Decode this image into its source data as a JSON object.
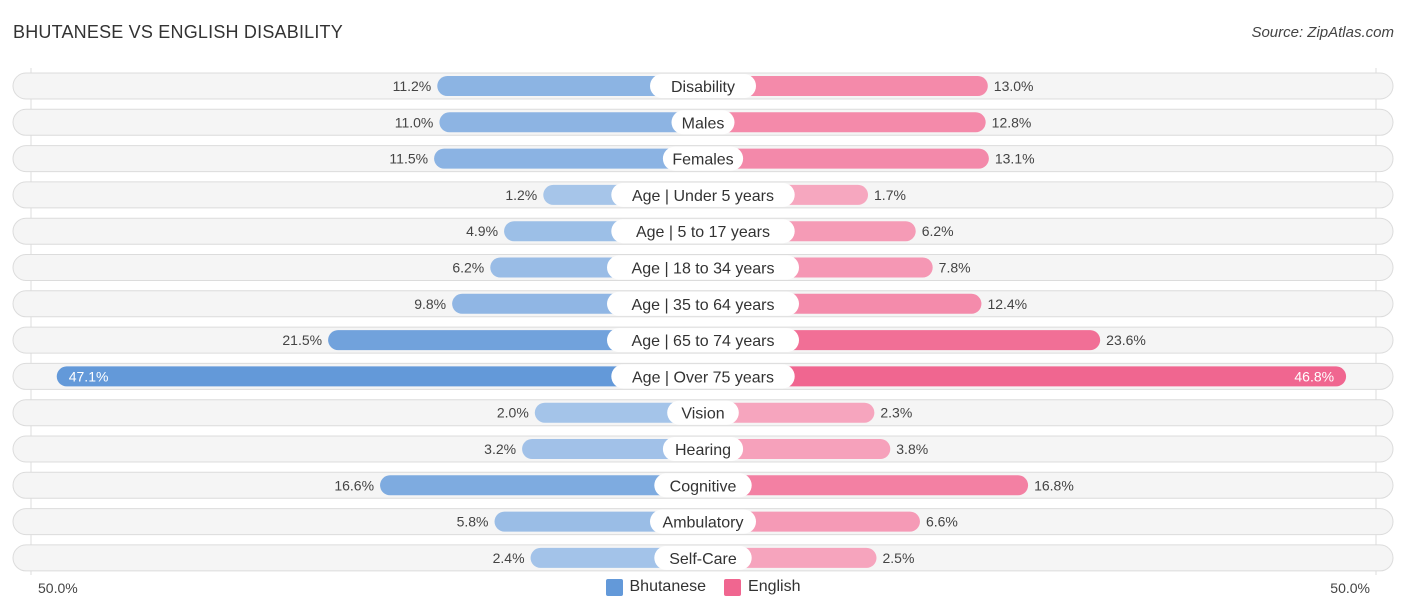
{
  "header": {
    "title": "BHUTANESE VS ENGLISH DISABILITY",
    "source": "Source: ZipAtlas.com"
  },
  "chart_data": {
    "type": "bar",
    "orientation": "horizontal-diverging",
    "title": "BHUTANESE VS ENGLISH DISABILITY",
    "categories": [
      "Disability",
      "Males",
      "Females",
      "Age | Under 5 years",
      "Age | 5 to 17 years",
      "Age | 18 to 34 years",
      "Age | 35 to 64 years",
      "Age | 65 to 74 years",
      "Age | Over 75 years",
      "Vision",
      "Hearing",
      "Cognitive",
      "Ambulatory",
      "Self-Care"
    ],
    "series": [
      {
        "name": "Bhutanese",
        "color": "#6399d9",
        "side": "left",
        "values": [
          11.2,
          11.0,
          11.5,
          1.2,
          4.9,
          6.2,
          9.8,
          21.5,
          47.1,
          2.0,
          3.2,
          16.6,
          5.8,
          2.4
        ],
        "labels": [
          "11.2%",
          "11.0%",
          "11.5%",
          "1.2%",
          "4.9%",
          "6.2%",
          "9.8%",
          "21.5%",
          "47.1%",
          "2.0%",
          "3.2%",
          "16.6%",
          "5.8%",
          "2.4%"
        ]
      },
      {
        "name": "English",
        "color": "#f06690",
        "side": "right",
        "values": [
          13.0,
          12.8,
          13.1,
          1.7,
          6.2,
          7.8,
          12.4,
          23.6,
          46.8,
          2.3,
          3.8,
          16.8,
          6.6,
          2.5
        ],
        "labels": [
          "13.0%",
          "12.8%",
          "13.1%",
          "1.7%",
          "6.2%",
          "7.8%",
          "12.4%",
          "23.6%",
          "46.8%",
          "2.3%",
          "3.8%",
          "16.8%",
          "6.6%",
          "2.5%"
        ]
      }
    ],
    "xlim": [
      -50,
      50
    ],
    "axis_labels": {
      "left": "50.0%",
      "right": "50.0%"
    },
    "legend": {
      "position": "bottom-center",
      "entries": [
        "Bhutanese",
        "English"
      ]
    },
    "grid": false
  }
}
